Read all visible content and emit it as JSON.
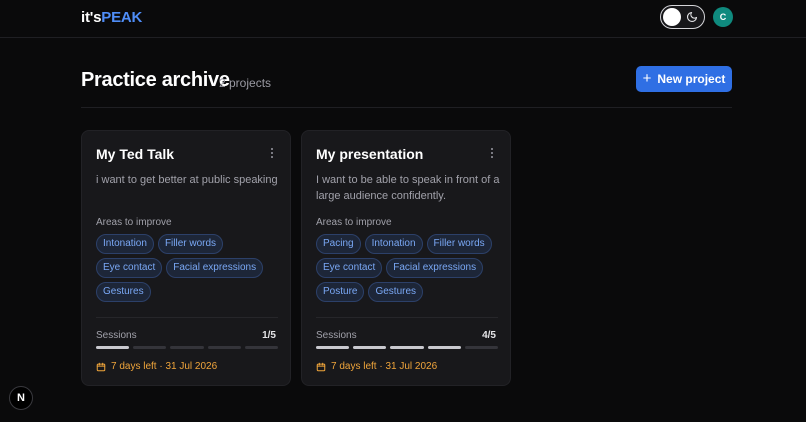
{
  "app": {
    "logo_prefix": "it's",
    "logo_suffix": "PEAK",
    "avatar_initial": "C",
    "brand_color": "#4f8df7"
  },
  "header": {
    "title": "Practice archive",
    "count": "2 projects",
    "new_button_label": "New project"
  },
  "labels": {
    "areas": "Areas to improve",
    "sessions": "Sessions"
  },
  "projects": [
    {
      "title": "My Ted Talk",
      "description": "i want to get better at public speaking",
      "tags": [
        "Intonation",
        "Filler words",
        "Eye contact",
        "Facial expressions",
        "Gestures"
      ],
      "sessions_done": 1,
      "sessions_total": 5,
      "sessions_text": "1/5",
      "deadline": "7 days left · 31 Jul 2026"
    },
    {
      "title": "My presentation",
      "description": "I want to be able to speak in front of a large audience confidently.",
      "tags": [
        "Pacing",
        "Intonation",
        "Filler words",
        "Eye contact",
        "Facial expressions",
        "Posture",
        "Gestures"
      ],
      "sessions_done": 4,
      "sessions_total": 5,
      "sessions_text": "4/5",
      "deadline": "7 days left · 31 Jul 2026"
    }
  ],
  "dev_badge": "N",
  "icons": {
    "theme": "moon-icon",
    "more": "more-vertical-icon",
    "calendar": "calendar-icon",
    "add": "plus-icon"
  }
}
